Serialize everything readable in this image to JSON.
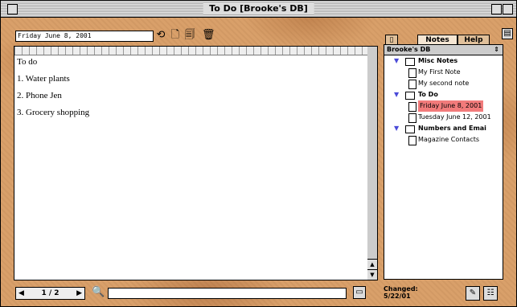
{
  "window": {
    "title": "To Do [Brooke's DB]"
  },
  "toolbar": {
    "date_field": "Friday June 8, 2001"
  },
  "note": {
    "lines": [
      "To do",
      "1. Water plants",
      "2. Phone Jen",
      "3. Grocery shopping"
    ]
  },
  "bottom": {
    "page_indicator": "1 / 2",
    "search_value": ""
  },
  "tabs": {
    "notes": "Notes",
    "help": "Help"
  },
  "tree": {
    "database": "Brooke's DB",
    "groups": [
      {
        "label": "Misc Notes",
        "items": [
          "My First Note",
          "My second note"
        ]
      },
      {
        "label": "To Do",
        "items": [
          "Friday June 8, 2001",
          "Tuesday June 12, 2001"
        ]
      },
      {
        "label": "Numbers and Emai",
        "items": [
          "Magazine Contacts"
        ]
      }
    ]
  },
  "status": {
    "changed_label": "Changed:",
    "changed_date": "5/22/01"
  },
  "colors": {
    "selection": "#f27b7b",
    "background": "#d9a06a"
  }
}
